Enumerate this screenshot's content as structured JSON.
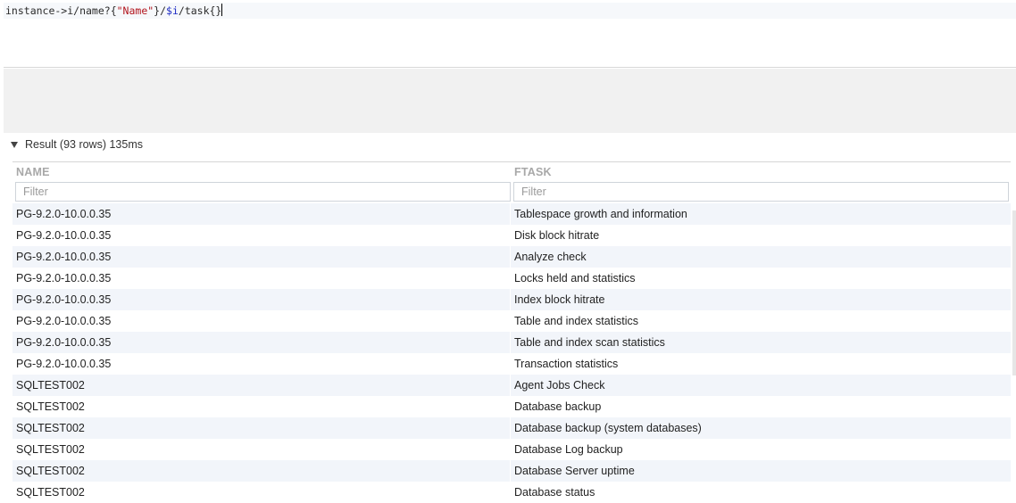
{
  "editor": {
    "query_tokens": [
      {
        "text": "instance->i/name?{",
        "kind": "plain"
      },
      {
        "text": "\"Name\"",
        "kind": "string"
      },
      {
        "text": "}/",
        "kind": "plain"
      },
      {
        "text": "$i",
        "kind": "var"
      },
      {
        "text": "/task{}",
        "kind": "plain"
      }
    ]
  },
  "result": {
    "summary": "Result (93 rows) 135ms"
  },
  "table": {
    "columns": [
      "NAME",
      "FTASK"
    ],
    "filter_placeholders": [
      "Filter",
      "Filter"
    ],
    "rows": [
      {
        "name": "PG-9.2.0-10.0.0.35",
        "ftask": "Tablespace growth and information"
      },
      {
        "name": "PG-9.2.0-10.0.0.35",
        "ftask": "Disk block hitrate"
      },
      {
        "name": "PG-9.2.0-10.0.0.35",
        "ftask": "Analyze check"
      },
      {
        "name": "PG-9.2.0-10.0.0.35",
        "ftask": "Locks held and statistics"
      },
      {
        "name": "PG-9.2.0-10.0.0.35",
        "ftask": "Index block hitrate"
      },
      {
        "name": "PG-9.2.0-10.0.0.35",
        "ftask": "Table and index statistics"
      },
      {
        "name": "PG-9.2.0-10.0.0.35",
        "ftask": "Table and index scan statistics"
      },
      {
        "name": "PG-9.2.0-10.0.0.35",
        "ftask": "Transaction statistics"
      },
      {
        "name": "SQLTEST002",
        "ftask": "Agent Jobs Check"
      },
      {
        "name": "SQLTEST002",
        "ftask": "Database backup"
      },
      {
        "name": "SQLTEST002",
        "ftask": "Database backup (system databases)"
      },
      {
        "name": "SQLTEST002",
        "ftask": "Database Log backup"
      },
      {
        "name": "SQLTEST002",
        "ftask": "Database Server uptime"
      },
      {
        "name": "SQLTEST002",
        "ftask": "Database status"
      }
    ]
  },
  "colors": {
    "row_alt": "#f2f5fa",
    "header_text": "#a8a8a8",
    "string_token": "#b2151d",
    "var_token": "#1d2bc4"
  }
}
